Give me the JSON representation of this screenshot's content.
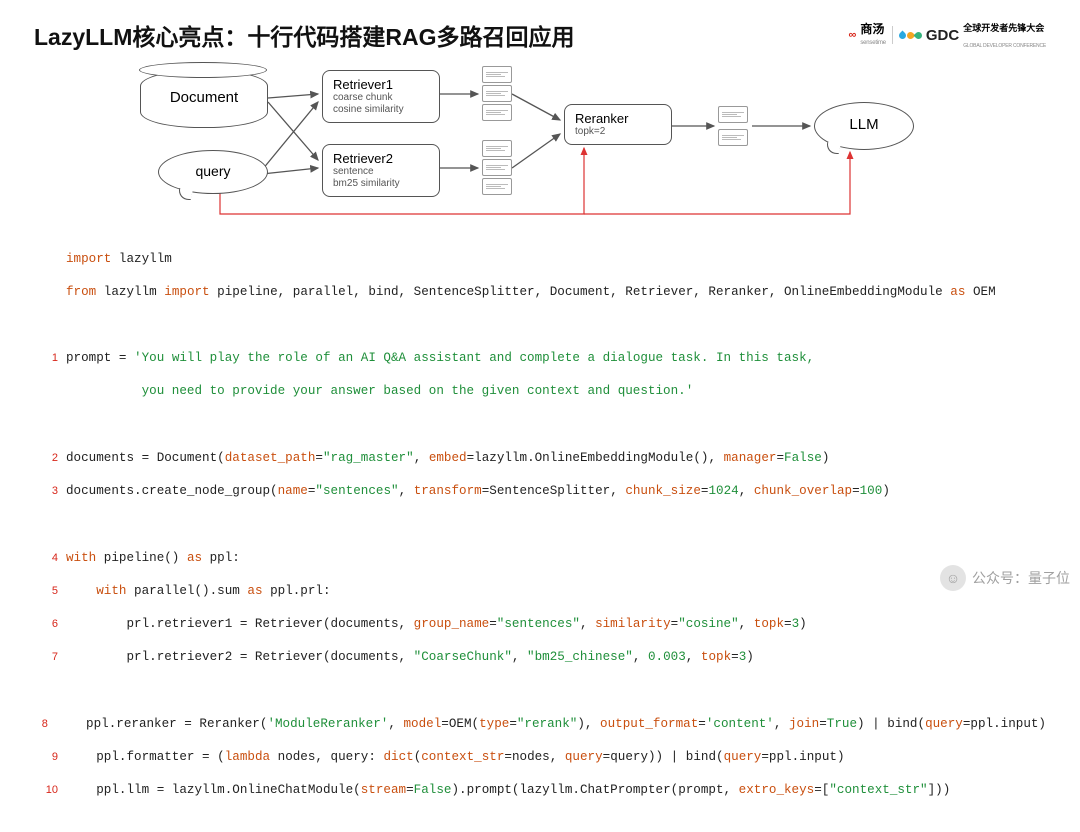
{
  "header": {
    "title": "LazyLLM核心亮点：十行代码搭建RAG多路召回应用",
    "logo_sense_cn": "商汤",
    "logo_sense_en": "sensetime",
    "logo_gdc": "GDC",
    "logo_gdc_cn": "全球开发者先锋大会",
    "logo_gdc_en": "GLOBAL DEVELOPER CONFERENCE"
  },
  "diagram": {
    "document": "Document",
    "query": "query",
    "retriever1": {
      "title": "Retriever1",
      "sub1": "coarse chunk",
      "sub2": "cosine similarity"
    },
    "retriever2": {
      "title": "Retriever2",
      "sub1": "sentence",
      "sub2": "bm25 similarity"
    },
    "reranker": {
      "title": "Reranker",
      "sub": "topk=2"
    },
    "llm": "LLM"
  },
  "code": {
    "l_import1_a": "import",
    "l_import1_b": " lazyllm",
    "l_import2_a": "from",
    "l_import2_b": " lazyllm ",
    "l_import2_c": "import",
    "l_import2_d": " pipeline, parallel, bind, SentenceSplitter, Document, Retriever, Reranker, OnlineEmbeddingModule ",
    "l_import2_e": "as",
    "l_import2_f": " OEM",
    "l1_a": "prompt = ",
    "l1_b": "'You will play the role of an AI Q&A assistant and complete a dialogue task. In this task,",
    "l1c_a": "          you need to provide your answer based on the given context and question.'",
    "l2_a": "documents = Document(",
    "l2_b": "dataset_path",
    "l2_c": "=",
    "l2_d": "\"rag_master\"",
    "l2_e": ", ",
    "l2_f": "embed",
    "l2_g": "=lazyllm.OnlineEmbeddingModule(), ",
    "l2_h": "manager",
    "l2_i": "=",
    "l2_j": "False",
    "l2_k": ")",
    "l3_a": "documents.create_node_group(",
    "l3_b": "name",
    "l3_c": "=",
    "l3_d": "\"sentences\"",
    "l3_e": ", ",
    "l3_f": "transform",
    "l3_g": "=SentenceSplitter, ",
    "l3_h": "chunk_size",
    "l3_i": "=",
    "l3_j": "1024",
    "l3_k": ", ",
    "l3_l": "chunk_overlap",
    "l3_m": "=",
    "l3_n": "100",
    "l3_o": ")",
    "l4_a": "with",
    "l4_b": " pipeline() ",
    "l4_c": "as",
    "l4_d": " ppl:",
    "l5_a": "    ",
    "l5_b": "with",
    "l5_c": " parallel().sum ",
    "l5_d": "as",
    "l5_e": " ppl.prl:",
    "l6_a": "        prl.retriever1 = Retriever(documents, ",
    "l6_b": "group_name",
    "l6_c": "=",
    "l6_d": "\"sentences\"",
    "l6_e": ", ",
    "l6_f": "similarity",
    "l6_g": "=",
    "l6_h": "\"cosine\"",
    "l6_i": ", ",
    "l6_j": "topk",
    "l6_k": "=",
    "l6_l": "3",
    "l6_m": ")",
    "l7_a": "        prl.retriever2 = Retriever(documents, ",
    "l7_b": "\"CoarseChunk\"",
    "l7_c": ", ",
    "l7_d": "\"bm25_chinese\"",
    "l7_e": ", ",
    "l7_f": "0.003",
    "l7_g": ", ",
    "l7_h": "topk",
    "l7_i": "=",
    "l7_j": "3",
    "l7_k": ")",
    "l8_a": "    ppl.reranker = Reranker(",
    "l8_b": "'ModuleReranker'",
    "l8_c": ", ",
    "l8_d": "model",
    "l8_e": "=OEM(",
    "l8_f": "type",
    "l8_g": "=",
    "l8_h": "\"rerank\"",
    "l8_i": "), ",
    "l8_j": "output_format",
    "l8_k": "=",
    "l8_l": "'content'",
    "l8_m": ", ",
    "l8_n": "join",
    "l8_o": "=",
    "l8_p": "True",
    "l8_q": ") | bind(",
    "l8_r": "query",
    "l8_s": "=ppl.input)",
    "l9_a": "    ppl.formatter = (",
    "l9_b": "lambda",
    "l9_c": " nodes, query: ",
    "l9_d": "dict",
    "l9_e": "(",
    "l9_f": "context_str",
    "l9_g": "=nodes, ",
    "l9_h": "query",
    "l9_i": "=query)) | bind(",
    "l9_j": "query",
    "l9_k": "=ppl.input)",
    "l10_a": "    ppl.llm = lazyllm.OnlineChatModule(",
    "l10_b": "stream",
    "l10_c": "=",
    "l10_d": "False",
    "l10_e": ").prompt(lazyllm.ChatPrompter(prompt, ",
    "l10_f": "extro_keys",
    "l10_g": "=[",
    "l10_h": "\"context_str\"",
    "l10_i": "]))"
  },
  "watermark": {
    "label": "公众号：量子位"
  }
}
